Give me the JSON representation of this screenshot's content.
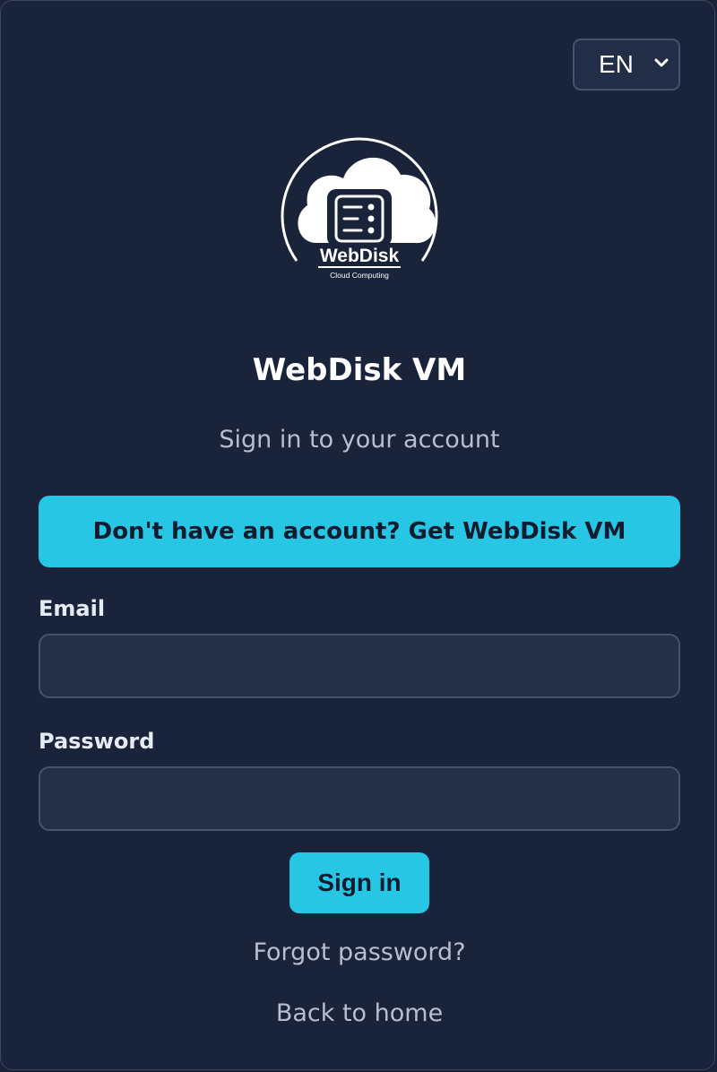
{
  "language": {
    "selected": "EN",
    "chevron_icon": "chevron-down-icon"
  },
  "logo": {
    "icon": "cloud-server-logo",
    "brand_text": "WebDisk",
    "tagline": "Cloud Computing"
  },
  "header": {
    "title": "WebDisk VM",
    "subtitle": "Sign in to your account"
  },
  "cta": {
    "label": "Don't have an account? Get WebDisk VM"
  },
  "form": {
    "email": {
      "label": "Email",
      "value": "",
      "placeholder": ""
    },
    "password": {
      "label": "Password",
      "value": "",
      "placeholder": ""
    },
    "submit_label": "Sign in"
  },
  "links": {
    "forgot_password": "Forgot password?",
    "back_home": "Back to home"
  },
  "colors": {
    "background": "#19233a",
    "accent": "#26c6e4",
    "input_bg": "#243048",
    "border": "#46526e",
    "muted_text": "#b7bfce"
  }
}
